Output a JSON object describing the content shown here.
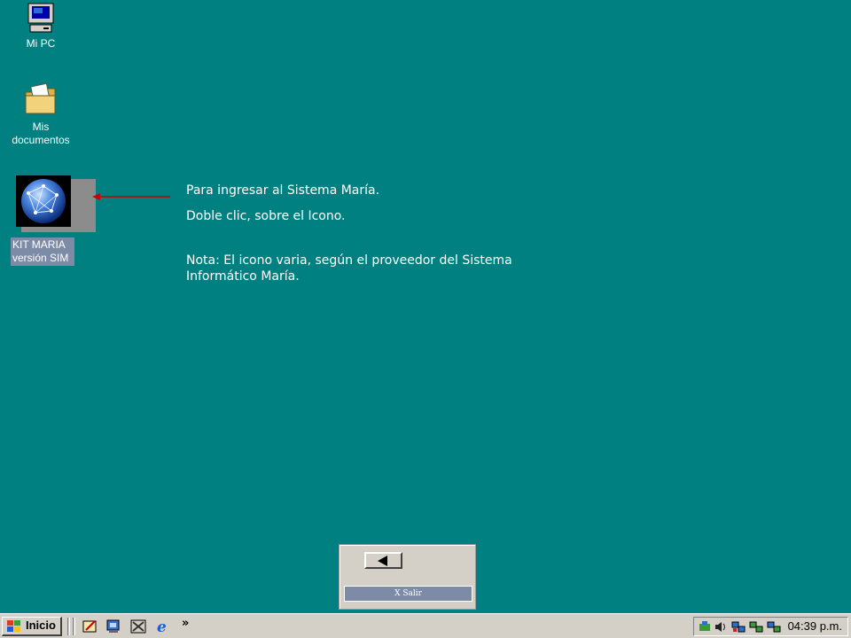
{
  "desktop": {
    "icons": [
      {
        "label": "Mi PC"
      },
      {
        "label": "Mis\ndocumentos"
      }
    ],
    "kit_icon": {
      "line1": "KIT MARIA",
      "line2": "versión SIM"
    }
  },
  "instructions": {
    "line1": "Para ingresar al Sistema María.",
    "line2": "Doble clic, sobre el Icono.",
    "note": "Nota: El icono varia, según el proveedor del Sistema Informático María."
  },
  "nav_panel": {
    "exit_label": "X  Salir"
  },
  "taskbar": {
    "start_label": "Inicio",
    "overflow": "»",
    "clock": "04:39 p.m."
  },
  "colors": {
    "desktop": "#008080",
    "arrow": "#cc0000",
    "label_bg": "#7d8ba6"
  }
}
